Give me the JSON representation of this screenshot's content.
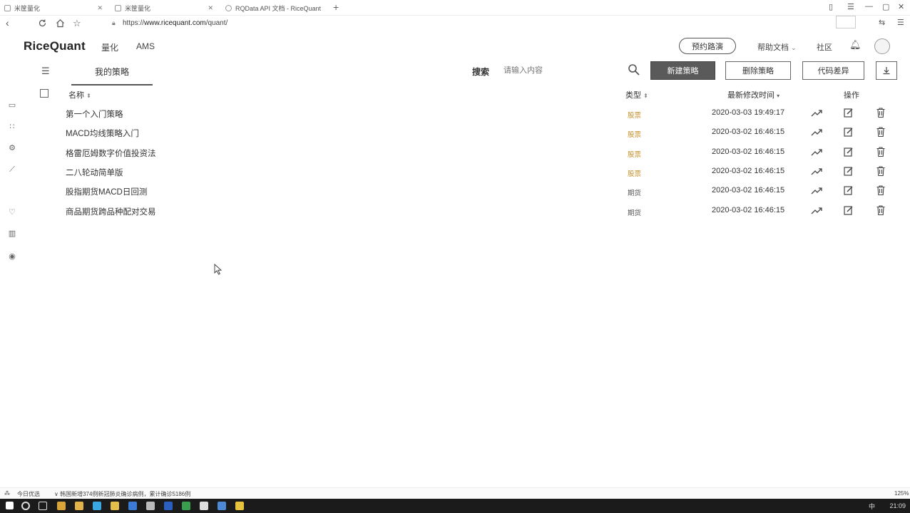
{
  "browser": {
    "tabs": [
      {
        "title": "米筐量化"
      },
      {
        "title": "米筐量化"
      },
      {
        "title": "RQData API 文档 - RiceQuant"
      }
    ],
    "url_scheme": "https://",
    "url_host": "www.ricequant.com",
    "url_path": "/quant/",
    "new_tab": "+"
  },
  "header": {
    "logo": "RiceQuant",
    "nav": [
      {
        "label": "量化"
      },
      {
        "label": "AMS"
      }
    ],
    "tutorial_button": "预约路演",
    "help_docs": "帮助文档",
    "community": "社区"
  },
  "toolbar": {
    "tab_label": "我的策略",
    "search_label": "搜索",
    "search_placeholder": "请输入内容",
    "new_button": "新建策略",
    "delete_button": "删除策略",
    "diff_button": "代码差异"
  },
  "table": {
    "col_name": "名称",
    "col_type": "类型",
    "col_time": "最新修改时间",
    "col_ops": "操作",
    "rows": [
      {
        "name": "第一个入门策略",
        "type": "股票",
        "time": "2020-03-03 19:49:17"
      },
      {
        "name": "MACD均线策略入门",
        "type": "股票",
        "time": "2020-03-02 16:46:15"
      },
      {
        "name": "格雷厄姆数字价值投资法",
        "type": "股票",
        "time": "2020-03-02 16:46:15"
      },
      {
        "name": "二八轮动简单版",
        "type": "股票",
        "time": "2020-03-02 16:46:15"
      },
      {
        "name": "股指期货MACD日回测",
        "type": "期货",
        "time": "2020-03-02 16:46:15"
      },
      {
        "name": "商品期货跨品种配对交易",
        "type": "期货",
        "time": "2020-03-02 16:46:15"
      }
    ]
  },
  "colors": {
    "stock_type": "#c8902a",
    "future_type": "#555555"
  },
  "statusbar": {
    "left": "今日优选",
    "news": "韩国新增374例新冠肺炎确诊病例，累计确诊5186例",
    "zoom": "125%"
  },
  "taskbar": {
    "clock": "21:09",
    "ime": "中"
  }
}
